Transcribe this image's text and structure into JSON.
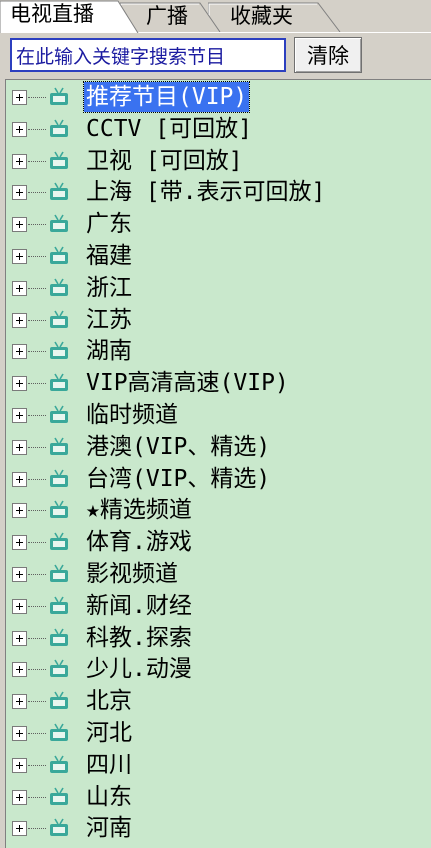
{
  "tabs": [
    {
      "label": "电视直播",
      "active": true
    },
    {
      "label": "广播",
      "active": false
    },
    {
      "label": "收藏夹",
      "active": false
    }
  ],
  "search": {
    "value": "在此输入关键字搜索节目",
    "clear_label": "清除"
  },
  "colors": {
    "tree_background": "#c9e8cc",
    "selection": "#3a72f0",
    "input_border": "#2c3fbf",
    "icon_teal": "#3aa89a"
  },
  "channels": [
    {
      "label": "推荐节目(VIP)",
      "selected": true
    },
    {
      "label": "CCTV [可回放]"
    },
    {
      "label": "卫视 [可回放]"
    },
    {
      "label": "上海 [带.表示可回放]"
    },
    {
      "label": "广东"
    },
    {
      "label": "福建"
    },
    {
      "label": "浙江"
    },
    {
      "label": "江苏"
    },
    {
      "label": "湖南"
    },
    {
      "label": "VIP高清高速(VIP)"
    },
    {
      "label": "临时频道"
    },
    {
      "label": "港澳(VIP、精选)"
    },
    {
      "label": "台湾(VIP、精选)"
    },
    {
      "label": "★精选频道"
    },
    {
      "label": "体育.游戏"
    },
    {
      "label": "影视频道"
    },
    {
      "label": "新闻.财经"
    },
    {
      "label": "科教.探索"
    },
    {
      "label": "少儿.动漫"
    },
    {
      "label": "北京"
    },
    {
      "label": "河北"
    },
    {
      "label": "四川"
    },
    {
      "label": "山东"
    },
    {
      "label": "河南"
    }
  ]
}
